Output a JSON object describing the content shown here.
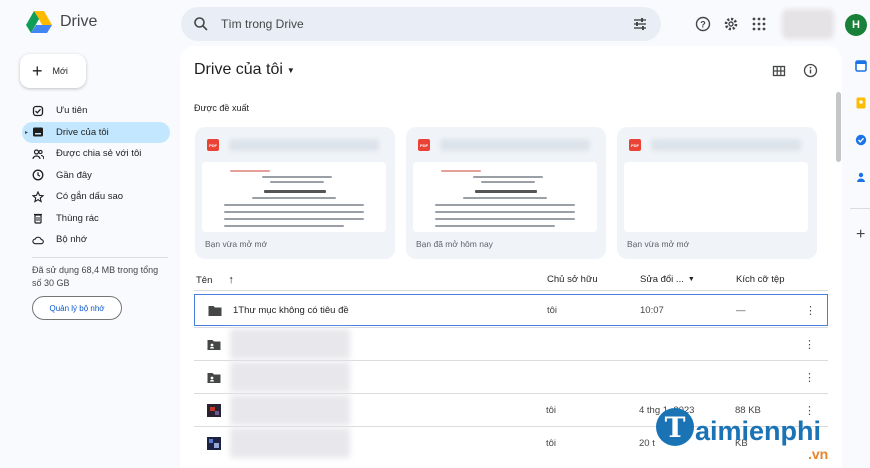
{
  "app": {
    "name": "Drive"
  },
  "search": {
    "placeholder": "Tìm trong Drive"
  },
  "account": {
    "avatar_letter": "H",
    "avatar_color": "#188038"
  },
  "new_button": {
    "label": "Mới"
  },
  "sidebar": {
    "items": [
      {
        "label": "Ưu tiên",
        "icon": "checkbox-circle-icon"
      },
      {
        "label": "Drive của tôi",
        "icon": "my-drive-icon",
        "active": true
      },
      {
        "label": "Được chia sẻ với tôi",
        "icon": "shared-people-icon"
      },
      {
        "label": "Gần đây",
        "icon": "clock-icon"
      },
      {
        "label": "Có gắn dấu sao",
        "icon": "star-icon"
      },
      {
        "label": "Thùng rác",
        "icon": "trash-icon"
      },
      {
        "label": "Bộ nhớ",
        "icon": "cloud-icon"
      }
    ],
    "storage_text": "Đã sử dụng 68,4 MB trong tổng số 30 GB",
    "manage_label": "Quản lý bộ nhớ"
  },
  "main": {
    "title": "Drive của tôi",
    "suggested_label": "Được đề xuất",
    "cards": [
      {
        "icon": "pdf-icon",
        "subtitle": "Bạn vừa mở mớ",
        "icon_text": "PDF"
      },
      {
        "icon": "pdf-icon",
        "subtitle": "Bạn đã mở hôm nay",
        "icon_text": "PDF"
      },
      {
        "icon": "pdf-icon",
        "subtitle": "Bạn vừa mở mớ",
        "icon_text": "PDF"
      }
    ],
    "columns": {
      "name": "Tên",
      "owner": "Chủ sở hữu",
      "modified": "Sửa đổi ...",
      "size": "Kích cỡ tệp"
    },
    "rows": [
      {
        "name": "1Thư mục không có tiêu đề",
        "owner": "tôi",
        "modified": "10:07",
        "size": "—",
        "type": "folder",
        "selected": true
      },
      {
        "name": "",
        "owner": "",
        "modified": "",
        "size": "",
        "type": "shared-folder"
      },
      {
        "name": "",
        "owner": "",
        "modified": "",
        "size": "",
        "type": "shared-folder"
      },
      {
        "name": "",
        "owner": "tôi",
        "modified": "4 thg 1, 2023",
        "size": "88 KB",
        "type": "image"
      },
      {
        "name": "",
        "owner": "tôi",
        "modified": "20 t",
        "size": "KB",
        "type": "image"
      }
    ]
  },
  "watermark": {
    "main": "aimienphi",
    "letter": "T",
    "suffix": ".vn"
  },
  "colors": {
    "active_nav": "#c2e7ff",
    "link_blue": "#0b57d0",
    "pdf_red": "#ea4335",
    "watermark_blue": "#1a73b5",
    "watermark_orange": "#e8842a"
  }
}
